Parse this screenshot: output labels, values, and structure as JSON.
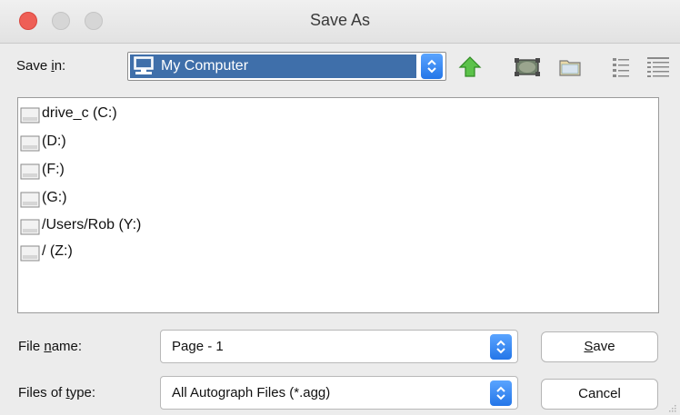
{
  "window": {
    "title": "Save As",
    "traffic_close_color": "#ee5f56"
  },
  "save_in": {
    "label_pre": "Save ",
    "label_mnemonic": "i",
    "label_post": "n:",
    "location": "My Computer",
    "location_icon": "computer-icon",
    "selection_color": "#3f6faa"
  },
  "toolbar": {
    "icons": [
      "up-folder-icon",
      "desktop-icon",
      "new-folder-icon",
      "list-view-icon",
      "details-view-icon"
    ]
  },
  "files": [
    {
      "name": "drive_c (C:)",
      "icon": "drive-icon"
    },
    {
      "name": " (D:)",
      "icon": "drive-icon"
    },
    {
      "name": " (F:)",
      "icon": "drive-icon"
    },
    {
      "name": " (G:)",
      "icon": "drive-icon"
    },
    {
      "name": "/Users/Rob (Y:)",
      "icon": "drive-icon"
    },
    {
      "name": "/ (Z:)",
      "icon": "drive-icon"
    }
  ],
  "file_name": {
    "label_pre": "File ",
    "label_mnemonic": "n",
    "label_post": "ame:",
    "value": "Page - 1"
  },
  "file_type": {
    "label_pre": "Files of ",
    "label_mnemonic": "t",
    "label_post": "ype:",
    "value": "All Autograph Files (*.agg)"
  },
  "buttons": {
    "save_mnemonic": "S",
    "save_rest": "ave",
    "cancel": "Cancel"
  }
}
